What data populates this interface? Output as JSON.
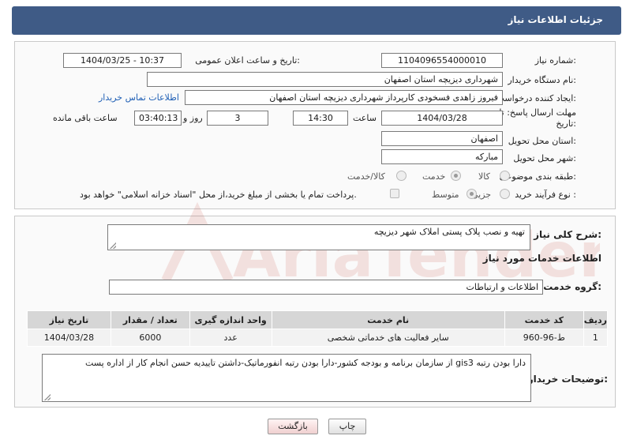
{
  "header": {
    "title": "جزئیات اطلاعات نیاز"
  },
  "form": {
    "need_number_label": "شماره نیاز:",
    "need_number": "1104096554000010",
    "announce_label": "تاریخ و ساعت اعلان عمومی:",
    "announce_value": "1404/03/25 - 10:37",
    "buyer_org_label": "نام دستگاه خریدار:",
    "buyer_org": "شهرداری دیزیچه استان اصفهان",
    "creator_label": "ایجاد کننده درخواست:",
    "creator": "فیروز زاهدی فسخودی کارپرداز شهرداری دیزیچه استان اصفهان",
    "contact_link": "اطلاعات تماس خریدار",
    "deadline_label_1": "مهلت ارسال پاسخ: تا",
    "deadline_label_2": "تاریخ:",
    "deadline_date": "1404/03/28",
    "time_label": "ساعت",
    "deadline_time": "14:30",
    "days_value": "3",
    "days_label": "روز و",
    "remaining_time": "03:40:13",
    "remaining_label": "ساعت باقی مانده",
    "province_label": "استان محل تحویل:",
    "province": "اصفهان",
    "city_label": "شهر محل تحویل:",
    "city": "مبارکه",
    "category_label": "طبقه بندی موضوعی:",
    "category_options": [
      "کالا",
      "خدمت",
      "کالا/خدمت"
    ],
    "category_selected": "خدمت",
    "process_label": "نوع فرآیند خرید :",
    "process_options": [
      "جزیی",
      "متوسط"
    ],
    "process_selected": "متوسط",
    "payment_note": "پرداخت تمام یا بخشی از مبلغ خرید،از محل \"اسناد خزانه اسلامی\" خواهد بود."
  },
  "details": {
    "summary_label": "شرح کلی نیاز:",
    "summary": "تهیه و نصب پلاک پستی املاک شهر دیزیچه",
    "services_heading": "اطلاعات خدمات مورد نیاز",
    "service_group_label": "گروه خدمت:",
    "service_group": "اطلاعات و ارتباطات",
    "table": {
      "headers": [
        "ردیف",
        "کد خدمت",
        "نام خدمت",
        "واحد اندازه گیری",
        "تعداد / مقدار",
        "تاریخ نیاز"
      ],
      "rows": [
        [
          "1",
          "ط-96-960",
          "سایر فعالیت های خدماتی شخصی",
          "عدد",
          "6000",
          "1404/03/28"
        ]
      ]
    },
    "buyer_notes_label": "توضیحات خریدار:",
    "buyer_notes": "دارا بودن رتبه gis3  از سازمان برنامه و بودجه کشور-دارا بودن رتبه انفورماتیک-داشتن تاییدیه حسن انجام کار از اداره پست"
  },
  "buttons": {
    "print": "چاپ",
    "back": "بازگشت"
  },
  "watermark_text": "AriaTender.neT",
  "colors": {
    "header": "#3f5b86",
    "link": "#1f5fb5",
    "watermark": "#c0392b"
  }
}
